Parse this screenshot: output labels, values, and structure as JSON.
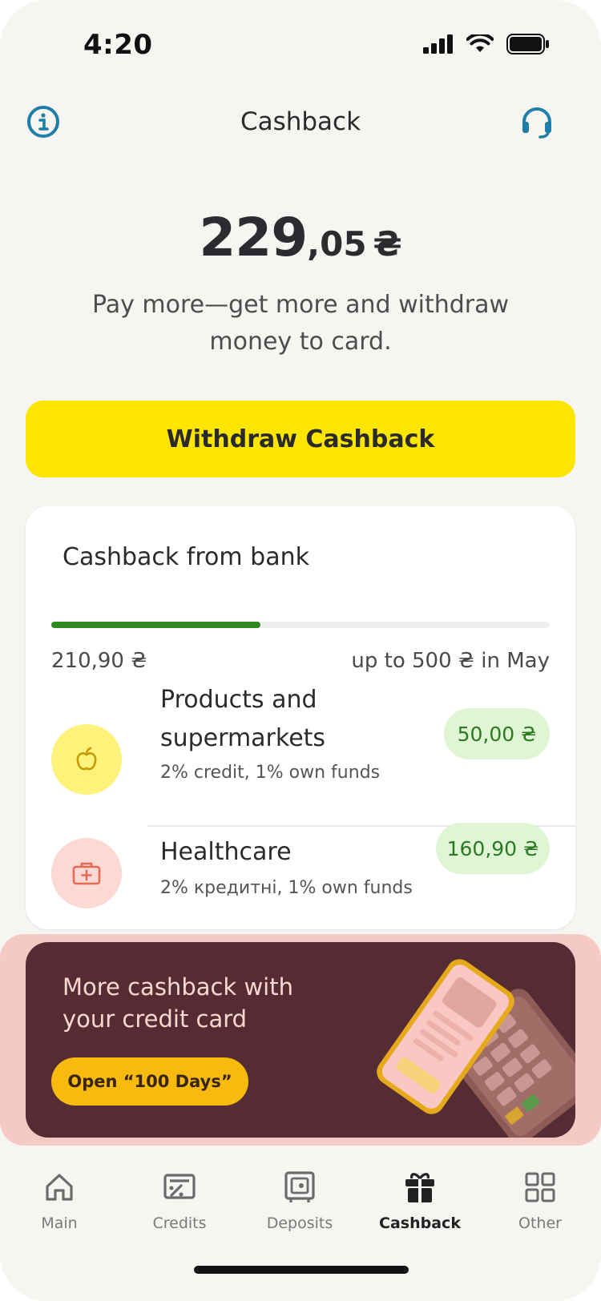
{
  "status_bar": {
    "time": "4:20"
  },
  "header": {
    "title": "Cashback"
  },
  "balance": {
    "integer": "229",
    "decimal": ",05",
    "currency": "₴"
  },
  "subtitle": "Pay more—get more and withdraw money to card.",
  "withdraw_button": {
    "label": "Withdraw Cashback"
  },
  "bank_card": {
    "title": "Cashback from bank",
    "progress_fraction": 0.42,
    "progress_color": "#2c8a1f",
    "amount_earned": "210,90 ₴",
    "limit_text": "up to 500 ₴ in May",
    "categories": [
      {
        "name": "Products and supermarkets",
        "conditions": "2% credit, 1% own funds",
        "amount": "50,00 ₴",
        "icon": "apple-icon"
      },
      {
        "name": "Healthcare",
        "conditions": "2% кредитні, 1% own funds",
        "amount": "160,90 ₴",
        "icon": "medical-case-icon"
      }
    ]
  },
  "promo": {
    "title": "More cashback with your credit card",
    "button_label": "Open “100 Days”"
  },
  "tabbar": {
    "tabs": [
      {
        "label": "Main",
        "icon": "home-icon"
      },
      {
        "label": "Credits",
        "icon": "credits-icon"
      },
      {
        "label": "Deposits",
        "icon": "safe-icon"
      },
      {
        "label": "Cashback",
        "icon": "gift-icon",
        "active": true
      },
      {
        "label": "Other",
        "icon": "grid-icon"
      }
    ]
  },
  "colors": {
    "accent_yellow": "#ffe600",
    "header_icon_blue": "#1f7fa8",
    "promo_bg": "#552c33",
    "pill_green_bg": "#dff5d4",
    "pill_green_text": "#2c7a22"
  }
}
